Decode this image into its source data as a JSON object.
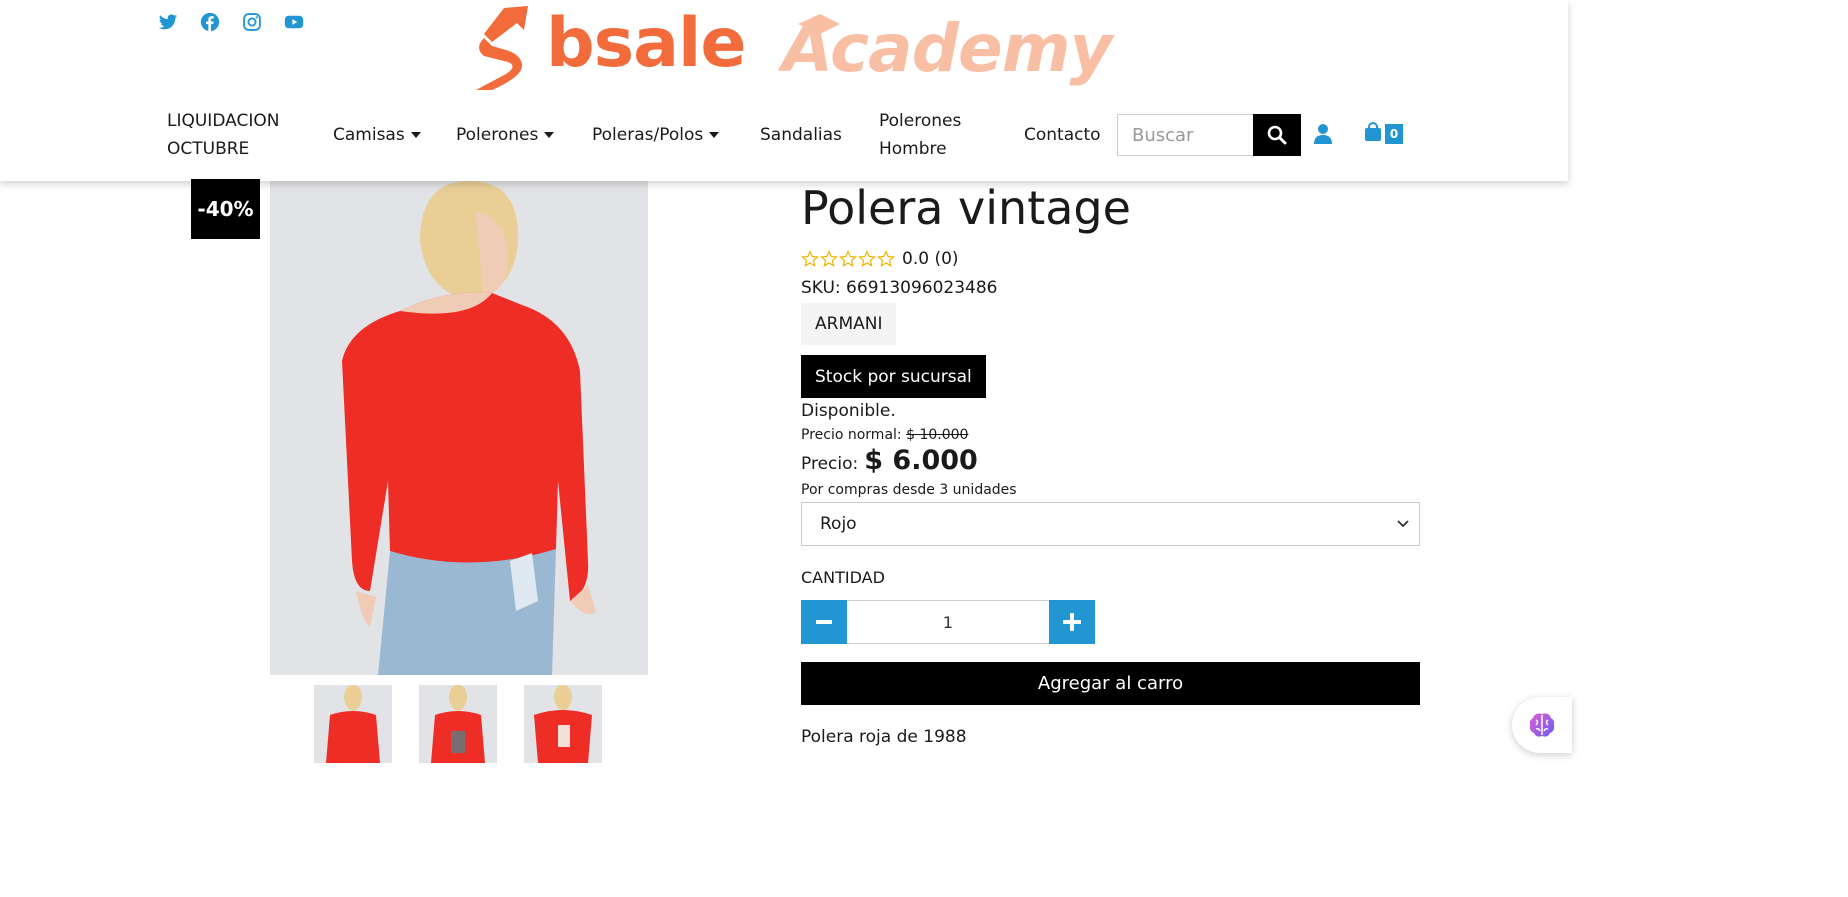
{
  "brand": {
    "logo_main": "bsale",
    "logo_secondary": "Academy",
    "primary_color": "#f26b3a",
    "secondary_color": "#f8bfa5",
    "accent_color": "#2196d3"
  },
  "social": [
    "twitter-icon",
    "facebook-icon",
    "instagram-icon",
    "youtube-icon"
  ],
  "nav": {
    "items": [
      {
        "label": "LIQUIDACION OCTUBRE",
        "dropdown": false
      },
      {
        "label": "Camisas",
        "dropdown": true
      },
      {
        "label": "Polerones",
        "dropdown": true
      },
      {
        "label": "Poleras/Polos",
        "dropdown": true
      },
      {
        "label": "Sandalias",
        "dropdown": false
      },
      {
        "label": "Polerones Hombre",
        "dropdown": false
      },
      {
        "label": "Contacto",
        "dropdown": false
      }
    ]
  },
  "search": {
    "placeholder": "Buscar"
  },
  "cart": {
    "count": "0"
  },
  "product": {
    "discount": "-40%",
    "title": "Polera vintage",
    "rating": {
      "stars": 0,
      "max": 5,
      "text": "0.0 (0)"
    },
    "sku": "SKU: 66913096023486",
    "brand": "ARMANI",
    "stock_button": "Stock por sucursal",
    "availability": "Disponible.",
    "normal_price_label": "Precio normal:",
    "normal_price": "$ 10.000",
    "price_label": "Precio:",
    "price": "$ 6.000",
    "bulk_note": "Por compras desde 3 unidades",
    "variant": "Rojo",
    "quantity_label": "CANTIDAD",
    "quantity": "1",
    "add_to_cart": "Agregar al carro",
    "description": "Polera roja de 1988",
    "thumbnails": 3
  }
}
